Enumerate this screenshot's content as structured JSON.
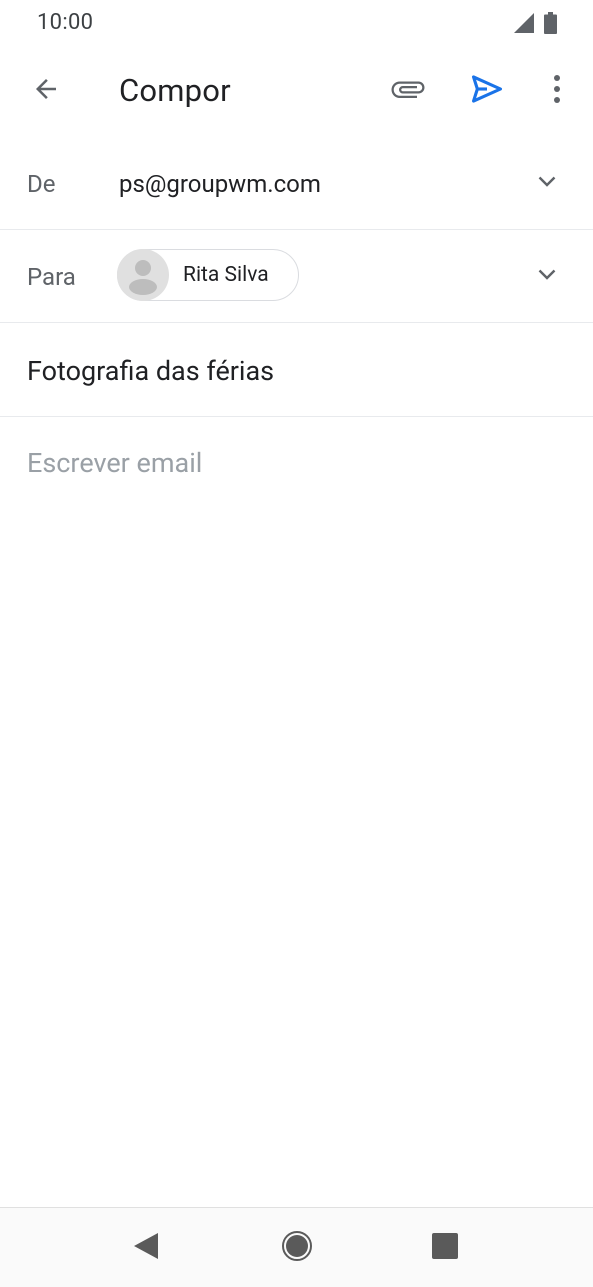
{
  "status_bar": {
    "time": "10:00",
    "icons": [
      "signal-icon",
      "battery-icon"
    ]
  },
  "app_bar": {
    "back_icon": "arrow-back-icon",
    "title": "Compor",
    "attach_icon": "paperclip-icon",
    "send_icon": "send-icon",
    "more_icon": "more-vert-icon"
  },
  "from_row": {
    "label": "De",
    "value": "ps@groupwm.com",
    "expand_icon": "chevron-down-icon"
  },
  "to_row": {
    "label": "Para",
    "recipients": [
      {
        "name": "Rita Silva",
        "avatar_icon": "person-icon"
      }
    ],
    "expand_icon": "chevron-down-icon"
  },
  "subject": {
    "value": "Fotografia das férias"
  },
  "body": {
    "value": "",
    "placeholder": "Escrever email"
  },
  "nav_bar": {
    "back_icon": "nav-back-triangle-icon",
    "home_icon": "nav-home-circle-icon",
    "recents_icon": "nav-recents-square-icon"
  },
  "colors": {
    "accent": "#1a73e8",
    "icon_gray": "#5f6368",
    "divider": "#e8eaed",
    "placeholder": "#9aa0a6",
    "nav_icon": "#5a5a5a"
  }
}
